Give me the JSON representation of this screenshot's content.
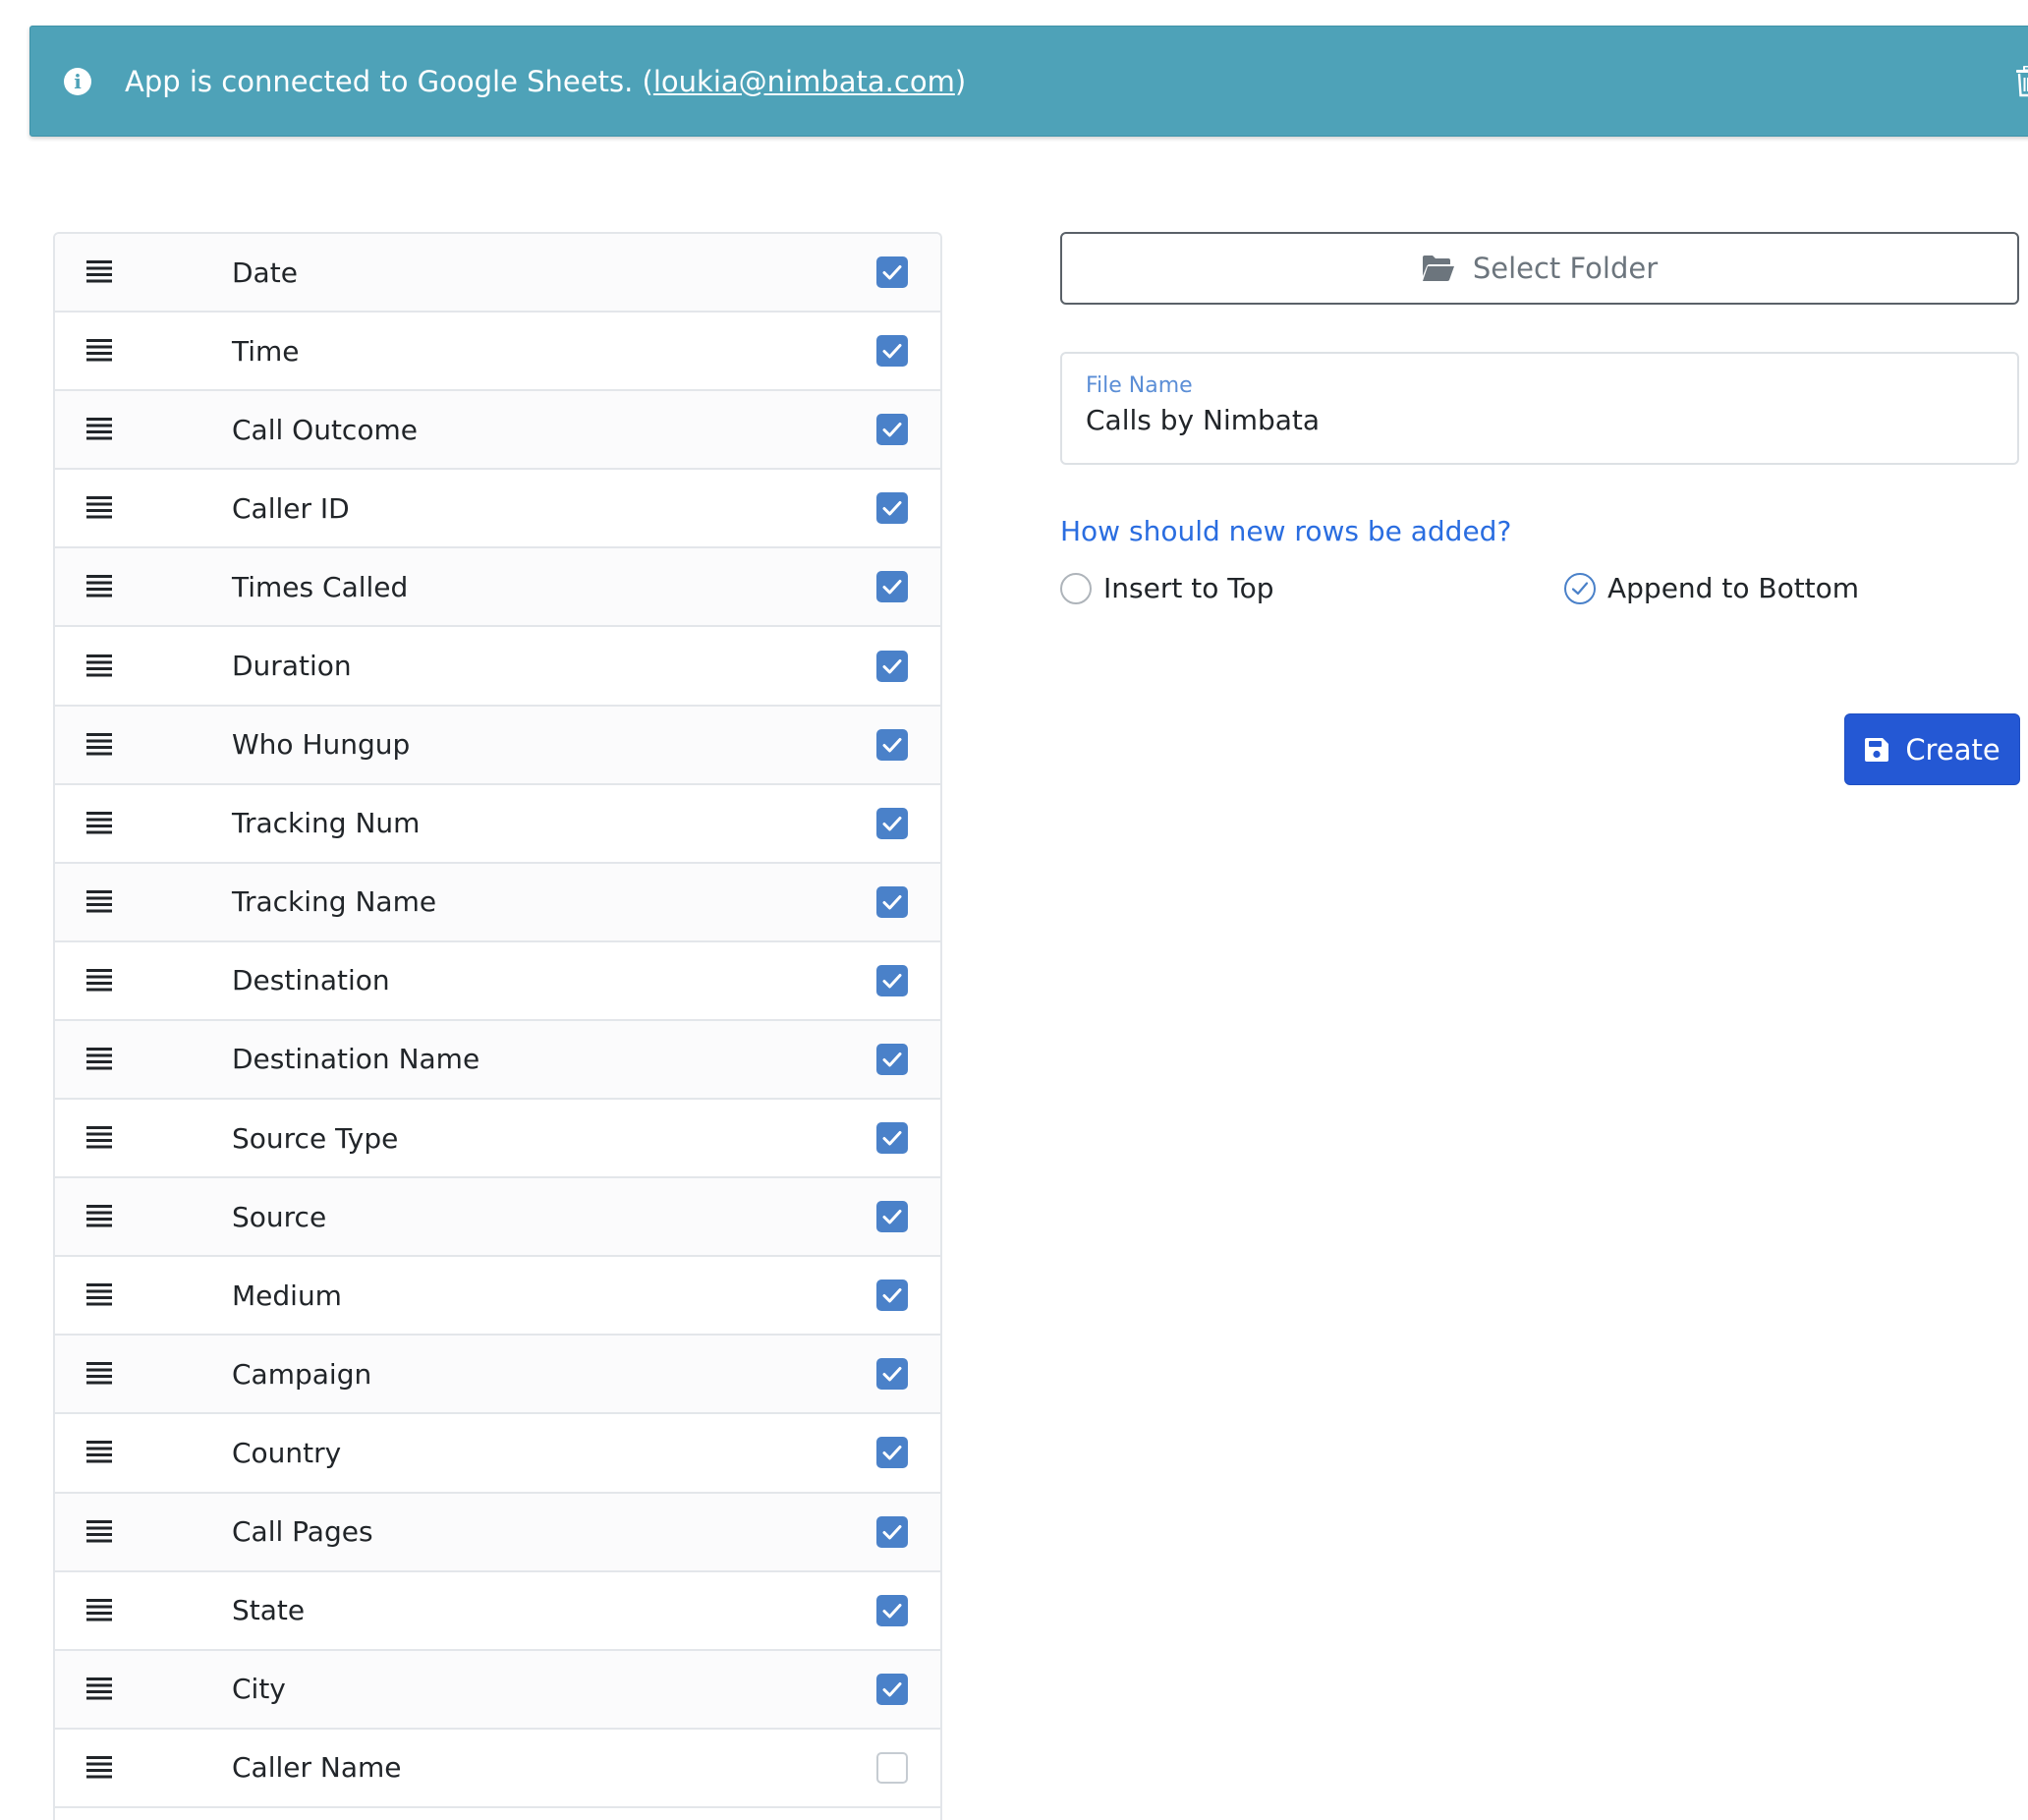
{
  "banner": {
    "text": "App is connected to Google Sheets. (",
    "email": "loukia@nimbata.com",
    "suffix": ")",
    "icon": "info-icon",
    "action_icon": "trash-icon",
    "color": "#4ea2b8"
  },
  "fields": [
    {
      "label": "Date",
      "checked": true
    },
    {
      "label": "Time",
      "checked": true
    },
    {
      "label": "Call Outcome",
      "checked": true
    },
    {
      "label": "Caller ID",
      "checked": true
    },
    {
      "label": "Times Called",
      "checked": true
    },
    {
      "label": "Duration",
      "checked": true
    },
    {
      "label": "Who Hungup",
      "checked": true
    },
    {
      "label": "Tracking Num",
      "checked": true
    },
    {
      "label": "Tracking Name",
      "checked": true
    },
    {
      "label": "Destination",
      "checked": true
    },
    {
      "label": "Destination Name",
      "checked": true
    },
    {
      "label": "Source Type",
      "checked": true
    },
    {
      "label": "Source",
      "checked": true
    },
    {
      "label": "Medium",
      "checked": true
    },
    {
      "label": "Campaign",
      "checked": true
    },
    {
      "label": "Country",
      "checked": true
    },
    {
      "label": "Call Pages",
      "checked": true
    },
    {
      "label": "State",
      "checked": true
    },
    {
      "label": "City",
      "checked": true
    },
    {
      "label": "Caller Name",
      "checked": false
    }
  ],
  "folder": {
    "label": "Select Folder",
    "icon": "folder-open-icon"
  },
  "file_name": {
    "label": "File Name",
    "value": "Calls by Nimbata"
  },
  "rows_option": {
    "question": "How should new rows be added?",
    "options": [
      {
        "label": "Insert to Top",
        "selected": false
      },
      {
        "label": "Append to Bottom",
        "selected": true
      }
    ]
  },
  "create": {
    "label": "Create",
    "icon": "save-icon",
    "color": "#2458d4"
  }
}
